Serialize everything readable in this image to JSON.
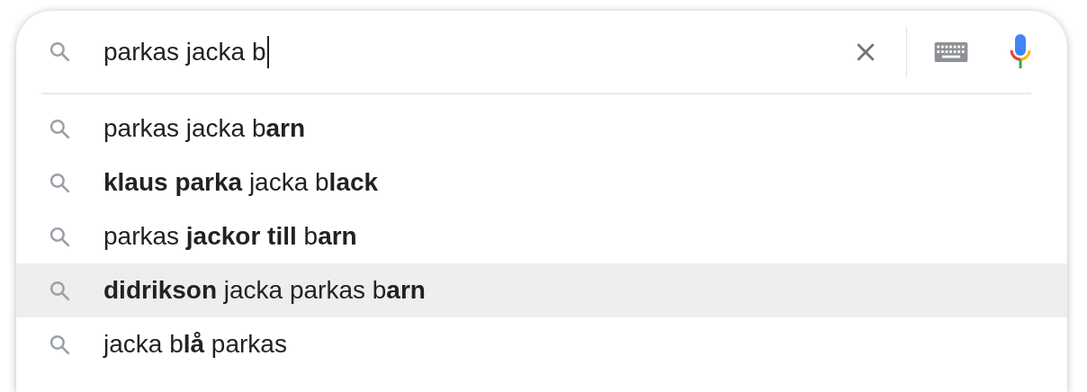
{
  "search": {
    "value": "parkas jacka b"
  },
  "suggestions": [
    {
      "text": "parkas jacka b**arn**",
      "selected": false
    },
    {
      "text": "**klaus parka** jacka b**lack**",
      "selected": false
    },
    {
      "text": "parkas **jackor till** b**arn**",
      "selected": false
    },
    {
      "text": "**didrikson** jacka parkas b**arn**",
      "selected": true
    },
    {
      "text": "jacka b**lå** parkas",
      "selected": false
    }
  ]
}
